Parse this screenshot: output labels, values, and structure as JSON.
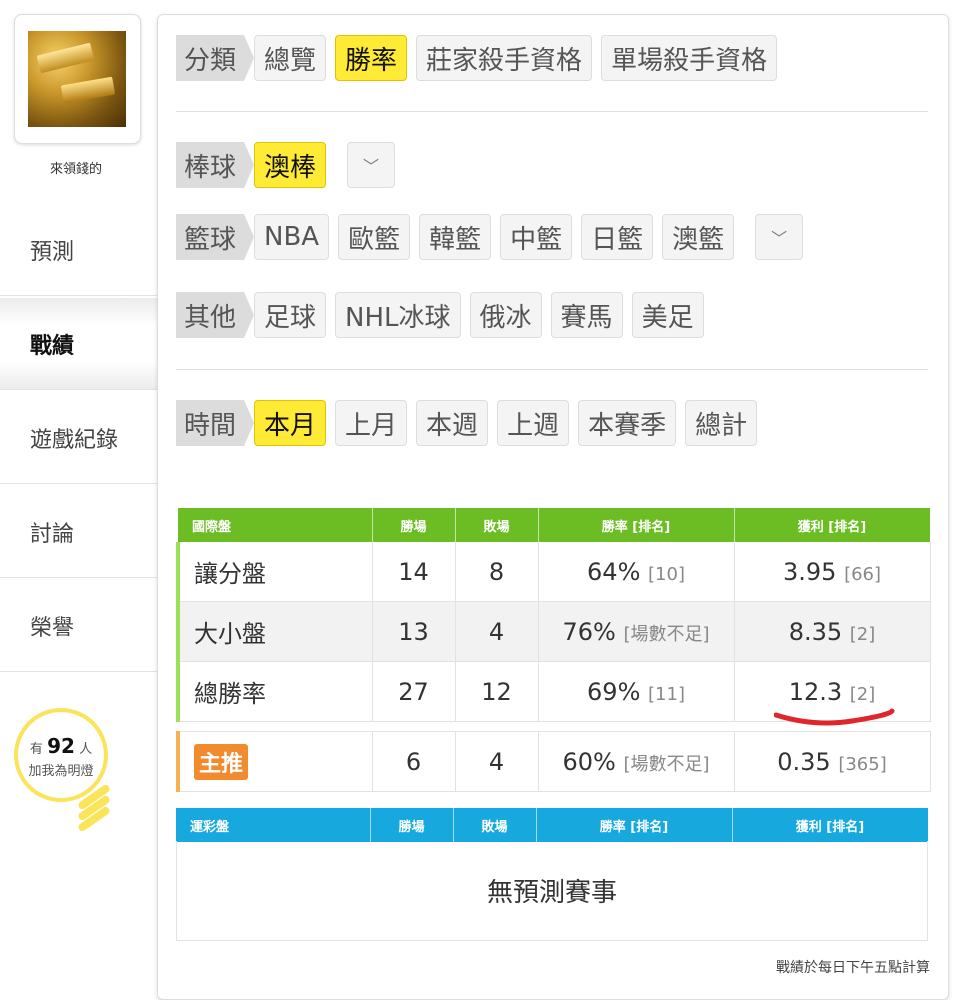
{
  "sidebar": {
    "username": "來領錢的",
    "nav": [
      "預測",
      "戰績",
      "遊戲紀錄",
      "討論",
      "榮譽"
    ],
    "active_nav": "戰績",
    "follow_prefix": "有",
    "follow_count": "92",
    "follow_suffix": "人",
    "follow_line2": "加我為明燈"
  },
  "category": {
    "label": "分類",
    "options": [
      "總覽",
      "勝率",
      "莊家殺手資格",
      "單場殺手資格"
    ],
    "selected": "勝率"
  },
  "baseball": {
    "label": "棒球",
    "options": [
      "澳棒"
    ],
    "selected": "澳棒"
  },
  "basketball": {
    "label": "籃球",
    "options": [
      "NBA",
      "歐籃",
      "韓籃",
      "中籃",
      "日籃",
      "澳籃"
    ]
  },
  "other": {
    "label": "其他",
    "options": [
      "足球",
      "NHL冰球",
      "俄冰",
      "賽馬",
      "美足"
    ]
  },
  "time": {
    "label": "時間",
    "options": [
      "本月",
      "上月",
      "本週",
      "上週",
      "本賽季",
      "總計"
    ],
    "selected": "本月"
  },
  "intl_table": {
    "headers": [
      "國際盤",
      "勝場",
      "敗場",
      "勝率 [排名]",
      "獲利 [排名]"
    ],
    "rows": [
      {
        "name": "讓分盤",
        "win": "14",
        "lose": "8",
        "rate": "64%",
        "rate_rank": "[10]",
        "profit": "3.95",
        "profit_rank": "[66]"
      },
      {
        "name": "大小盤",
        "win": "13",
        "lose": "4",
        "rate": "76%",
        "rate_rank": "[場數不足]",
        "profit": "8.35",
        "profit_rank": "[2]"
      },
      {
        "name": "總勝率",
        "win": "27",
        "lose": "12",
        "rate": "69%",
        "rate_rank": "[11]",
        "profit": "12.3",
        "profit_rank": "[2]"
      }
    ],
    "main_pick": {
      "name": "主推",
      "win": "6",
      "lose": "4",
      "rate": "60%",
      "rate_rank": "[場數不足]",
      "profit": "0.35",
      "profit_rank": "[365]"
    }
  },
  "lottery_table": {
    "headers": [
      "運彩盤",
      "勝場",
      "敗場",
      "勝率 [排名]",
      "獲利 [排名]"
    ],
    "empty_text": "無預測賽事"
  },
  "footnote": "戰績於每日下午五點計算",
  "colors": {
    "selected": "#ffea35",
    "green_header": "#6cbd24",
    "blue_header": "#17a9de",
    "badge": "#f28a2e",
    "annotation": "#e0262b"
  }
}
